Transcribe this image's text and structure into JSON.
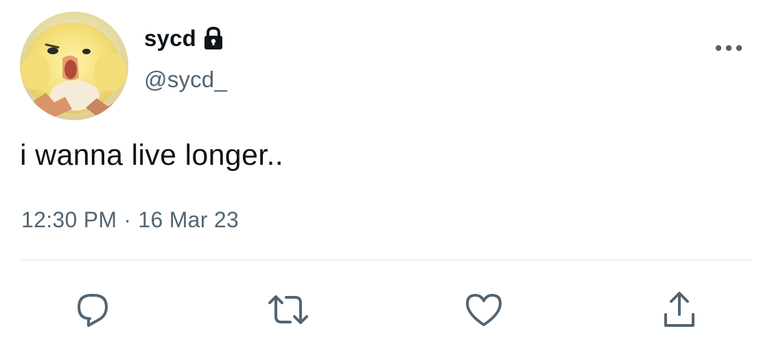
{
  "user": {
    "display_name": "sycd",
    "handle": "@sycd_",
    "protected": true,
    "avatar_icon": "yellow-chick-avatar"
  },
  "tweet": {
    "text": "i wanna live longer..",
    "time": "12:30 PM",
    "separator": "·",
    "date": "16 Mar 23"
  },
  "icons": {
    "more": "more-horizontal-icon",
    "lock": "lock-icon",
    "reply": "reply-icon",
    "retweet": "retweet-icon",
    "like": "heart-icon",
    "share": "share-icon"
  },
  "colors": {
    "text_primary": "#0f1419",
    "text_secondary": "#536471",
    "divider": "#eff3f4",
    "icon": "#536471"
  }
}
